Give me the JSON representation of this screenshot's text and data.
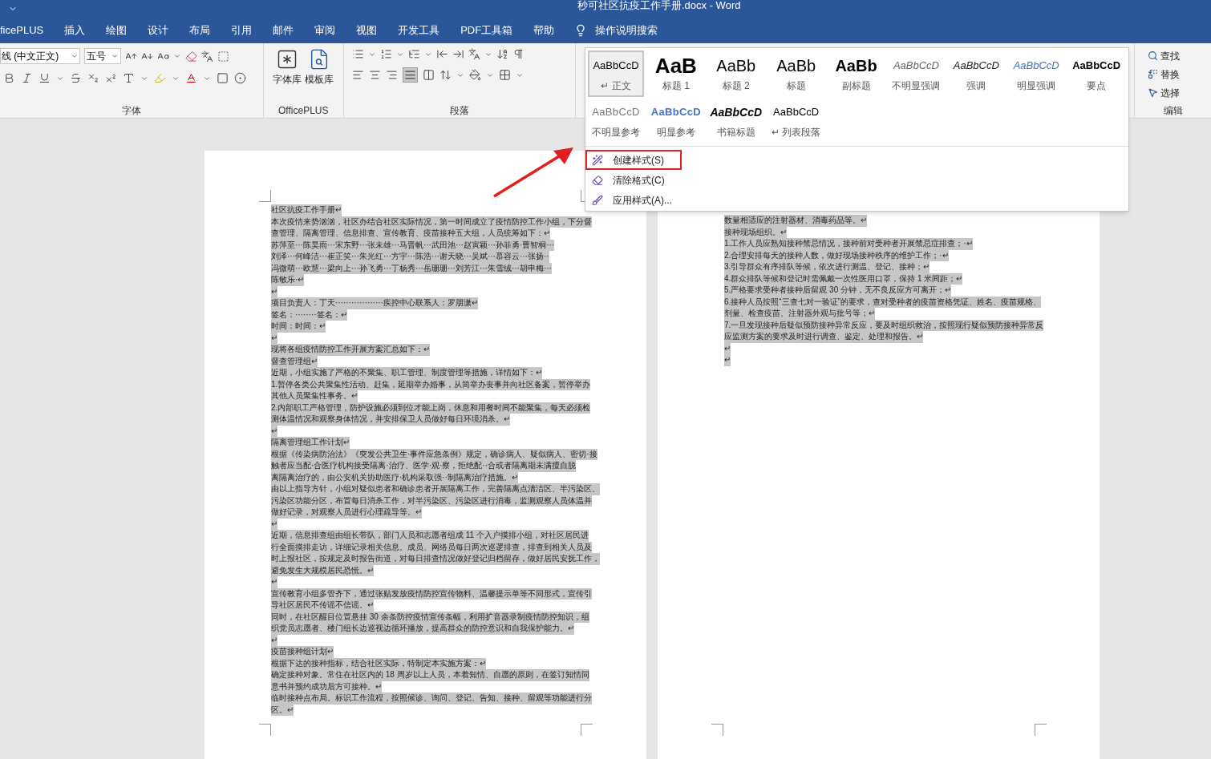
{
  "window": {
    "title": "秒可社区抗疫工作手册.docx  -  Word"
  },
  "ribbon_tabs": [
    {
      "label": "ficePLUS",
      "selected": false
    },
    {
      "label": "插入",
      "selected": false
    },
    {
      "label": "绘图",
      "selected": false
    },
    {
      "label": "设计",
      "selected": false
    },
    {
      "label": "布局",
      "selected": false
    },
    {
      "label": "引用",
      "selected": false
    },
    {
      "label": "邮件",
      "selected": false
    },
    {
      "label": "审阅",
      "selected": false
    },
    {
      "label": "视图",
      "selected": false
    },
    {
      "label": "开发工具",
      "selected": false
    },
    {
      "label": "PDF工具箱",
      "selected": false
    },
    {
      "label": "帮助",
      "selected": false
    }
  ],
  "tell_me": "操作说明搜索",
  "font_group": {
    "font_name": "线 (中文正文)",
    "font_size": "五号",
    "label": "字体"
  },
  "officeplus_group": {
    "buttons": [
      "字体库",
      "模板库"
    ],
    "label": "OfficePLUS"
  },
  "paragraph_group": {
    "label": "段落"
  },
  "editing_group": {
    "items": [
      "查找",
      "替换",
      "选择"
    ],
    "label": "编辑"
  },
  "styles_menu": {
    "styles": [
      {
        "preview": "AaBbCcD",
        "name": "↵ 正文",
        "kind": "normal",
        "selected": true
      },
      {
        "preview": "AaB",
        "name": "标题 1",
        "kind": "heading1",
        "selected": false
      },
      {
        "preview": "AaBb",
        "name": "标题 2",
        "kind": "heading2",
        "selected": false
      },
      {
        "preview": "AaBb",
        "name": "标题",
        "kind": "title",
        "selected": false
      },
      {
        "preview": "AaBb",
        "name": "副标题",
        "kind": "subtitle",
        "selected": false
      },
      {
        "preview": "AaBbCcD",
        "name": "不明显强调",
        "kind": "subtle",
        "selected": false
      },
      {
        "preview": "AaBbCcD",
        "name": "强调",
        "kind": "emphasis",
        "selected": false
      },
      {
        "preview": "AaBbCcD",
        "name": "明显强调",
        "kind": "intense",
        "selected": false
      },
      {
        "preview": "AaBbCcD",
        "name": "要点",
        "kind": "strong",
        "selected": false
      },
      {
        "preview": "AaBbCcD",
        "name": "不明显参考",
        "kind": "subtle_ref",
        "selected": false
      },
      {
        "preview": "AaBbCcD",
        "name": "明显参考",
        "kind": "intense_ref",
        "selected": false
      },
      {
        "preview": "AaBbCcD",
        "name": "书籍标题",
        "kind": "book",
        "selected": false
      },
      {
        "preview": "AaBbCcD",
        "name": "↵ 列表段落",
        "kind": "normal",
        "selected": false
      }
    ],
    "commands": [
      {
        "label": "创建样式(S)",
        "kind": "create",
        "highlighted": true
      },
      {
        "label": "清除格式(C)",
        "kind": "clear",
        "highlighted": false
      },
      {
        "label": "应用样式(A)...",
        "kind": "apply",
        "highlighted": false
      }
    ]
  },
  "pages": [
    {
      "lines": [
        "社区抗疫工作手册↵",
        "本次疫情来势汹汹，社区办结合社区实际情况，第一时间成立了疫情防控工作小组，下分督",
        "查管理、隔离管理、信息排查、宣传教育、疫苗接种五大组，人员统筹如下：↵",
        "苏萍至···陈昊雨···宋东野···张未雄···马晋帆···武田池···赵寅颖···孙菲勇·曹智桐···",
        "刘泽···何峰洁···崔正笑···朱光红···方宇···陈浩···谢天晓···吴斌···慕容云···张扬··",
        "冯微萌···欧慧···梁向上···孙飞勇···丁杨秀···岳珊珊···刘芳江···朱雪绒···胡申梅···",
        "陈敏乐·↵",
        "↵",
        "项目负责人：丁天··················疾控中心联系人：罗朋潇↵",
        "签名：········签名：↵",
        "时间：时间：↵",
        "↵",
        "现将各组疫情防控工作开展方案汇总如下：↵",
        "督查管理组↵",
        "近期，小组实施了严格的不聚集、职工管理、制度管理等措施，详情如下：↵",
        "1.暂停各类公共聚集性活动、赶集，延期举办婚事，从简举办丧事并向社区备案，暂停举办",
        "其他人员聚集性事务。↵",
        "2.内部职工严格管理，防护设施必须到位才能上岗，休息和用餐时间不能聚集，每天必须检",
        "测体温情况和观察身体情况，并安排保卫人员做好每日环境消杀。↵",
        "↵",
        "隔离管理组工作计划↵",
        "根据《传染病防治法》《突发公共卫生·事件应急条例》规定，确诊病人、疑似病人、密切·接",
        "触者应当配·合医疗机构接受隔离·治疗、医学·观·察，拒绝配··合或者隔离期未满擅自脱",
        "离隔离治疗的，由公安机关协助医疗·机构采取强··制隔离治疗措施。↵",
        "由以上指导方针，小组对疑似患者和确诊患者开展隔离工作，完善隔离点清洁区、半污染区、",
        "污染区功能分区，布置每日消杀工作，对半污染区、污染区进行消毒，监测观察人员体温并",
        "做好记录，对观察人员进行心理疏导等。↵",
        "↵",
        "近期，信息排查组由组长带队，部门人员和志愿者组成 11 个入户摸排小组，对社区居民进",
        "行全面摸排走访，详细记录相关信息。成员、网络员每日两次巡逻排查，排查到相关人员及",
        "时上报社区，按规定及时报告街道，对每日排查情况做好登记归档留存，做好居民安抚工作，",
        "避免发生大规模居民恐慌。↵",
        "↵",
        "宣传教育小组多管齐下，通过张贴发放疫情防控宣传物料、温馨提示单等不同形式，宣传引",
        "导社区居民不传谣不信谣。↵",
        "同时，在社区醒目位置悬挂 30 余条防控疫情宣传条幅，利用扩音器录制疫情防控知识，组",
        "织党员志愿者、楼门组长边巡视边循环播放，提高群众的防控意识和自我保护能力。↵",
        "↵",
        "疫苗接种组计划↵",
        "根据下达的接种指标，结合社区实际，特制定本实施方案：↵",
        "确定接种对象。常住在社区内的 18 周岁以上人员，本着知情、自愿的原则，在签订知情同",
        "意书并预约成功后方可接种。↵",
        "临时接种点布局。标识工作流程，按照候诊、询问、登记、告知、接种、留观等功能进行分",
        "区。↵"
      ]
    },
    {
      "lines": [
        "数量相适应的注射器材、消毒药品等。↵",
        "接种现场组织。↵",
        "1.工作人员应熟知接种禁忌情况，接种前对受种者开展禁忌症排查；·↵",
        "2.合理安排每天的接种人数，做好现场接种秩序的维护工作；·↵",
        "3.引导群众有序排队等候，依次进行测温、登记、接种；↵",
        "4.群众排队等候和登记时需佩戴一次性医用口罩，保持 1 米间距；↵",
        "5.严格要求受种者接种后留观 30 分钟，无不良反应方可离开；↵",
        "6.接种人员按照“三查七对一验证”的要求，查对受种者的疫苗资格凭证、姓名、疫苗规格、",
        "剂量、检查疫苗、注射器外观与批号等；↵",
        "7.一旦发现接种后疑似预防接种异常反应，要及时组织救治，按照现行疑似预防接种异常反",
        "应监测方案的要求及时进行调查、鉴定、处理和报告。↵",
        "↵",
        "↵"
      ]
    }
  ]
}
